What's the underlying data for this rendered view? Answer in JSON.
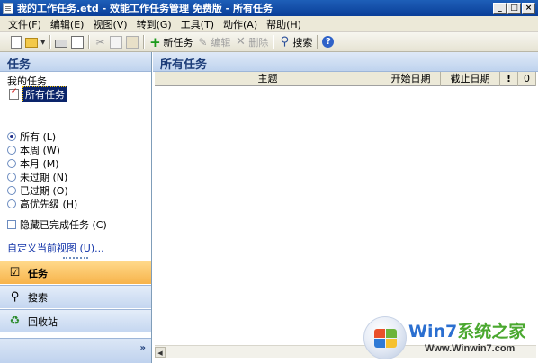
{
  "window": {
    "title": "我的工作任务.etd - 效能工作任务管理 免费版 - 所有任务",
    "controls": [
      "_",
      "□",
      "×"
    ]
  },
  "menu": [
    "文件(F)",
    "编辑(E)",
    "视图(V)",
    "转到(G)",
    "工具(T)",
    "动作(A)",
    "帮助(H)"
  ],
  "toolbar": {
    "new_task": "新任务",
    "edit": "编辑",
    "delete": "删除",
    "search": "搜索"
  },
  "nav": {
    "header": "任务",
    "section": "我的任务",
    "folder": "所有任务",
    "filters": [
      {
        "label": "所有 (L)",
        "selected": true
      },
      {
        "label": "本周 (W)",
        "selected": false
      },
      {
        "label": "本月 (M)",
        "selected": false
      },
      {
        "label": "未过期 (N)",
        "selected": false
      },
      {
        "label": "已过期 (O)",
        "selected": false
      },
      {
        "label": "高优先级 (H)",
        "selected": false
      }
    ],
    "hide_completed": "隐藏已完成任务 (C)",
    "customize_link": "自定义当前视图 (U)...",
    "buttons": [
      "任务",
      "搜索",
      "回收站"
    ],
    "expand": "»"
  },
  "content": {
    "header": "所有任务",
    "columns": [
      "主题",
      "开始日期",
      "截止日期",
      "!",
      "0"
    ]
  },
  "watermark": {
    "brand_main": "Win7",
    "brand_accent": "系统之家",
    "url": "Www.Winwin7.com"
  },
  "colors": {
    "title_bar": "#0a3e98",
    "pane_header_text": "#1c3c78",
    "active_nav": "#f7b34a",
    "link": "#1032a8"
  }
}
